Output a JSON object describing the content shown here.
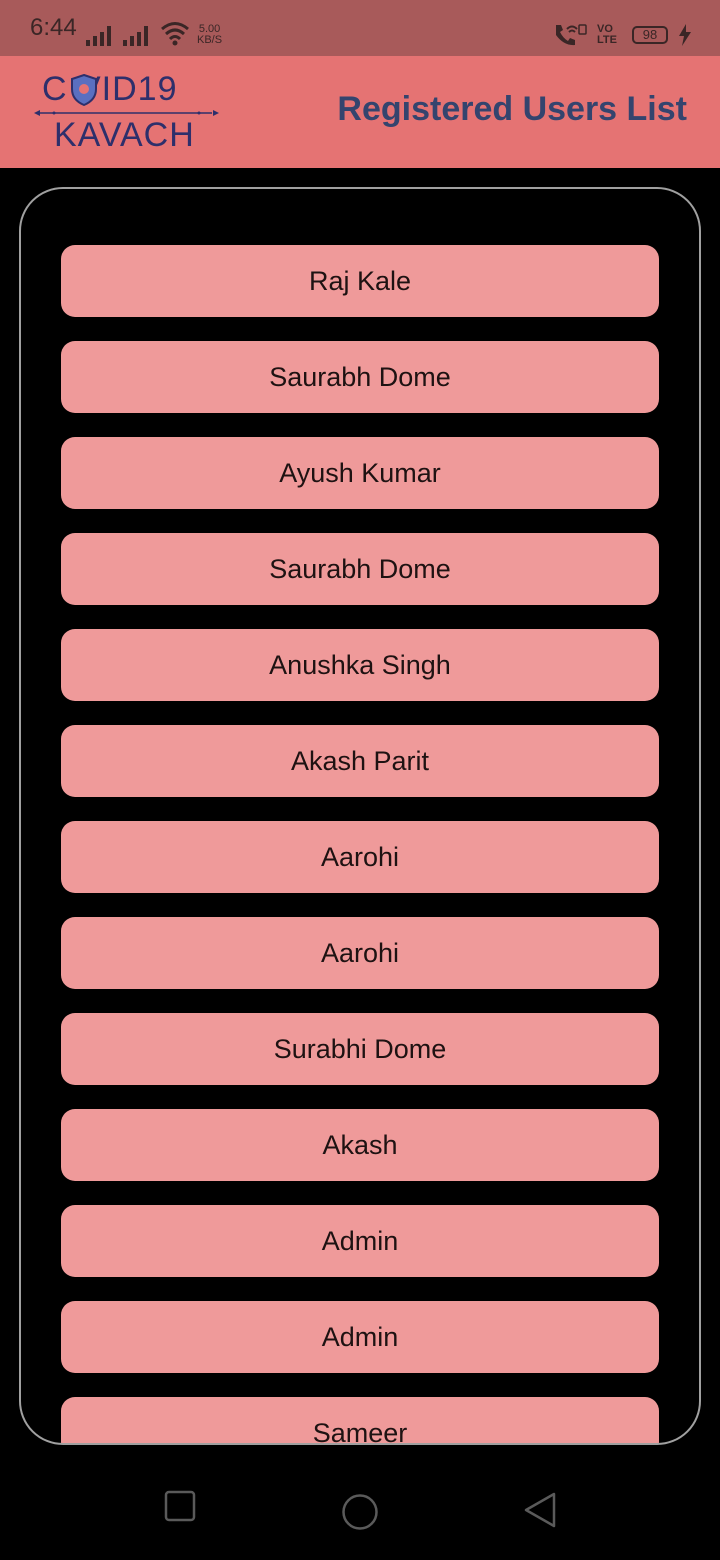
{
  "status_bar": {
    "time": "6:44",
    "speed_value": "5.00",
    "speed_unit": "KB/S",
    "volte_line1": "VO",
    "volte_line2": "LTE",
    "battery": "98"
  },
  "app_bar": {
    "logo_top": "C  VID19",
    "logo_bottom": "KAVACH",
    "title": "Registered Users List"
  },
  "users": [
    "Raj Kale",
    "Saurabh Dome",
    "Ayush Kumar",
    "Saurabh Dome",
    "Anushka Singh",
    "Akash Parit",
    "Aarohi",
    "Aarohi",
    "Surabhi Dome",
    "Akash",
    "Admin",
    "Admin",
    "Sameer"
  ],
  "colors": {
    "status_bar": "#a85a5a",
    "app_bar": "#e57373",
    "item_bg": "#ef9a9a",
    "title_text": "#34446e",
    "logo_text": "#2e2f6b"
  },
  "icons": {
    "nav_recent": "square-icon",
    "nav_home": "circle-icon",
    "nav_back": "triangle-back-icon"
  }
}
